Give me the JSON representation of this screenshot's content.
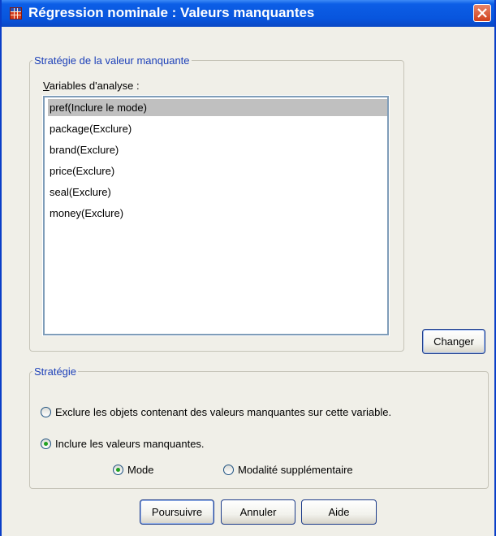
{
  "window": {
    "title": "Régression nominale : Valeurs manquantes",
    "icon": "grid-table-icon",
    "close_icon": "close-icon"
  },
  "strategy_group": {
    "legend": "Stratégie de la valeur manquante",
    "variables_label": "Variables d'analyse :",
    "variables": [
      {
        "label": "pref(Inclure le mode)",
        "selected": true
      },
      {
        "label": "package(Exclure)",
        "selected": false
      },
      {
        "label": "brand(Exclure)",
        "selected": false
      },
      {
        "label": "price(Exclure)",
        "selected": false
      },
      {
        "label": "seal(Exclure)",
        "selected": false
      },
      {
        "label": "money(Exclure)",
        "selected": false
      }
    ],
    "change_button": "Changer"
  },
  "strategie": {
    "legend": "Stratégie",
    "exclude_option": "Exclure les objets contenant des valeurs manquantes sur cette variable.",
    "include_option": "Inclure les valeurs manquantes.",
    "mode_option": "Mode",
    "supplementary_option": "Modalité supplémentaire",
    "selected": "include",
    "include_sub_selected": "mode"
  },
  "buttons": {
    "continue": "Poursuivre",
    "cancel": "Annuler",
    "help": "Aide"
  },
  "colors": {
    "titlebar": "#0855dd",
    "group_legend": "#1b3fb8",
    "selected_row": "#c0c0c0",
    "radio_dot": "#21a121"
  }
}
